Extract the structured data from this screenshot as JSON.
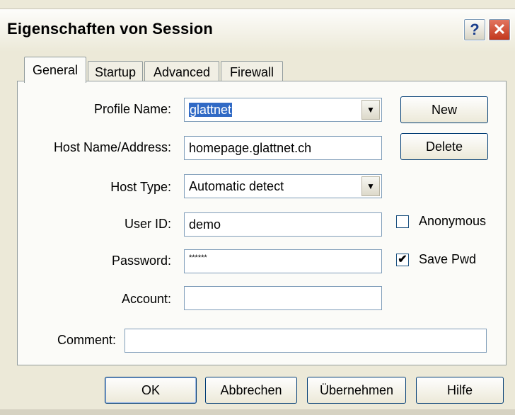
{
  "window": {
    "title": "Eigenschaften von Session",
    "help_glyph": "?",
    "close_glyph": "✕"
  },
  "tabs": [
    {
      "label": "General"
    },
    {
      "label": "Startup"
    },
    {
      "label": "Advanced"
    },
    {
      "label": "Firewall"
    }
  ],
  "form": {
    "profile_label": "Profile Name:",
    "profile_value": "glattnet",
    "host_label": "Host Name/Address:",
    "host_value": "homepage.glattnet.ch",
    "host_type_label": "Host Type:",
    "host_type_value": "Automatic detect",
    "user_label": "User ID:",
    "user_value": "demo",
    "password_label": "Password:",
    "password_value": "******",
    "account_label": "Account:",
    "account_value": "",
    "comment_label": "Comment:",
    "comment_value": ""
  },
  "side_buttons": {
    "new": "New",
    "delete": "Delete"
  },
  "checkboxes": {
    "anonymous": {
      "label": "Anonymous",
      "checked": false,
      "mark": ""
    },
    "save_pwd": {
      "label": "Save Pwd",
      "checked": true,
      "mark": "✔"
    }
  },
  "footer": {
    "ok": "OK",
    "cancel": "Abbrechen",
    "apply": "Übernehmen",
    "help": "Hilfe"
  },
  "icons": {
    "dropdown": "▼"
  }
}
